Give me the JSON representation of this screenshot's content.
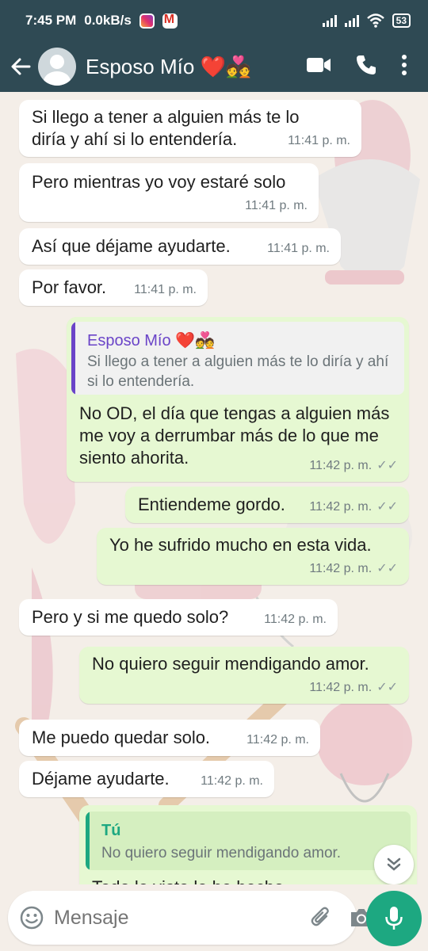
{
  "status_bar": {
    "time": "7:45 PM",
    "network_speed": "0.0kB/s",
    "battery": "53",
    "icons": [
      "instagram-icon",
      "gmail-icon",
      "signal-icon",
      "wifi-icon",
      "battery-icon"
    ]
  },
  "header": {
    "contact_name": "Esposo Mío ❤️💑",
    "icons": [
      "back-arrow-icon",
      "video-call-icon",
      "voice-call-icon",
      "more-options-icon"
    ]
  },
  "messages": [
    {
      "dir": "in",
      "text": "Si llego a tener a alguien más te lo diría y ahí si lo entendería.",
      "time": "11:41 p. m."
    },
    {
      "dir": "in",
      "text": "Pero mientras yo voy estaré solo",
      "time": "11:41 p. m."
    },
    {
      "dir": "in",
      "text": "Así que déjame ayudarte.",
      "time": "11:41 p. m."
    },
    {
      "dir": "in",
      "text": "Por favor.",
      "time": "11:41 p. m."
    },
    {
      "dir": "out",
      "quote": {
        "author": "Esposo Mío ❤️💑",
        "text": "Si llego a tener a alguien más te lo diría y ahí si lo entendería."
      },
      "text": "No OD, el día que tengas a alguien más me voy a derrumbar más de lo que me siento ahorita.",
      "time": "11:42 p. m."
    },
    {
      "dir": "out",
      "text": "Entiendeme gordo.",
      "time": "11:42 p. m."
    },
    {
      "dir": "out",
      "text": "Yo he sufrido mucho en esta vida.",
      "time": "11:42 p. m."
    },
    {
      "dir": "in",
      "text": "Pero y si me quedo solo?",
      "time": "11:42 p. m."
    },
    {
      "dir": "out",
      "text": "No quiero seguir mendigando amor.",
      "time": "11:42 p. m."
    },
    {
      "dir": "in",
      "text": "Me puedo quedar solo.",
      "time": "11:42 p. m."
    },
    {
      "dir": "in",
      "text": "Déjame ayudarte.",
      "time": "11:42 p. m."
    },
    {
      "dir": "out",
      "quote": {
        "author": "Tú",
        "text": "No quiero seguir mendigando amor."
      },
      "text": "Todo lo visto lo he hecho...",
      "time": ""
    }
  ],
  "input": {
    "placeholder": "Mensaje",
    "icons": [
      "emoji-icon",
      "attach-icon",
      "camera-icon",
      "mic-icon"
    ]
  },
  "colors": {
    "header_bg": "#2f4a54",
    "outgoing_bubble": "#e6f8d2",
    "incoming_bubble": "#ffffff",
    "accent_green": "#1da881",
    "quote_purple": "#6a44c8",
    "quote_green": "#1da881"
  }
}
